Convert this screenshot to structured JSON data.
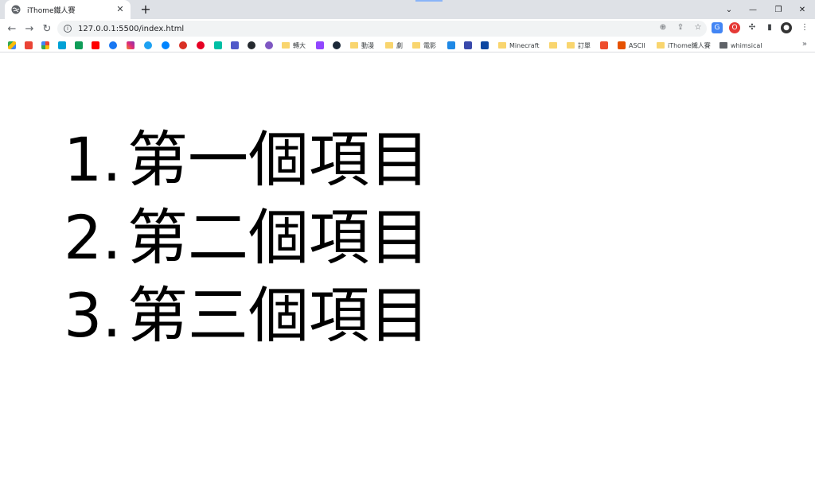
{
  "browser": {
    "tab": {
      "title": "iThome鐵人賽",
      "close": "✕"
    },
    "new_tab": "+",
    "window": {
      "dropdown": "⌄",
      "minimize": "—",
      "restore": "❐",
      "close": "✕"
    },
    "address": {
      "url": "127.0.0.1:5500/index.html"
    },
    "bookmarks": [
      {
        "label": "轉大",
        "kind": "folder"
      },
      {
        "label": "動漫",
        "kind": "folder"
      },
      {
        "label": "劇",
        "kind": "folder"
      },
      {
        "label": "電影",
        "kind": "folder"
      },
      {
        "label": "Minecraft",
        "kind": "folder"
      },
      {
        "label": "訂單",
        "kind": "folder"
      },
      {
        "label": "ASCII",
        "kind": "site"
      },
      {
        "label": "iThome鐵人賽",
        "kind": "folder"
      },
      {
        "label": "whimsical",
        "kind": "folder"
      }
    ],
    "more": "»"
  },
  "page": {
    "items": [
      {
        "marker": "1.",
        "text": "第一個項目"
      },
      {
        "marker": "2.",
        "text": "第二個項目"
      },
      {
        "marker": "3.",
        "text": "第三個項目"
      }
    ]
  }
}
